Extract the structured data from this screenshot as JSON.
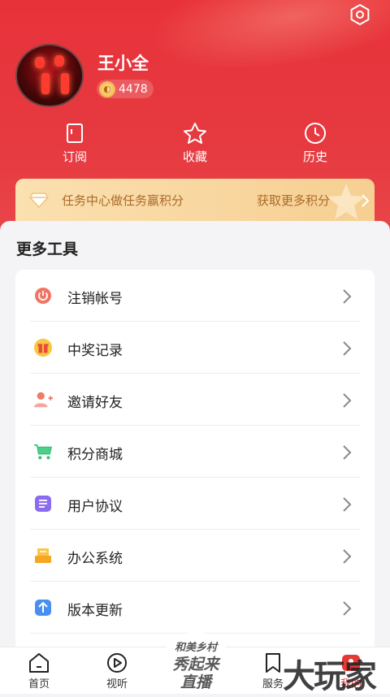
{
  "profile": {
    "name": "王小全",
    "points": "4478"
  },
  "quick_nav": [
    {
      "label": "订阅",
      "icon": "bookmark-icon"
    },
    {
      "label": "收藏",
      "icon": "star-icon"
    },
    {
      "label": "历史",
      "icon": "clock-icon"
    }
  ],
  "task_banner": {
    "text": "任务中心做任务赢积分",
    "link": "获取更多积分"
  },
  "tools": {
    "title": "更多工具",
    "items": [
      {
        "label": "注销帐号",
        "icon": "power-icon"
      },
      {
        "label": "中奖记录",
        "icon": "gift-icon"
      },
      {
        "label": "邀请好友",
        "icon": "add-user-icon"
      },
      {
        "label": "积分商城",
        "icon": "cart-icon"
      },
      {
        "label": "用户协议",
        "icon": "document-icon"
      },
      {
        "label": "办公系统",
        "icon": "office-icon"
      },
      {
        "label": "版本更新",
        "icon": "update-icon"
      }
    ]
  },
  "bottom_nav": {
    "home": "首页",
    "video": "视听",
    "live_line1": "和美乡村",
    "live_line2": "秀起来",
    "live_line3": "直播",
    "service": "服务",
    "mine": "我的"
  },
  "watermark": "大玩家",
  "colors": {
    "brand_red": "#e8323a",
    "banner_gold": "#f6cf92",
    "active_tab": "#e53935"
  }
}
